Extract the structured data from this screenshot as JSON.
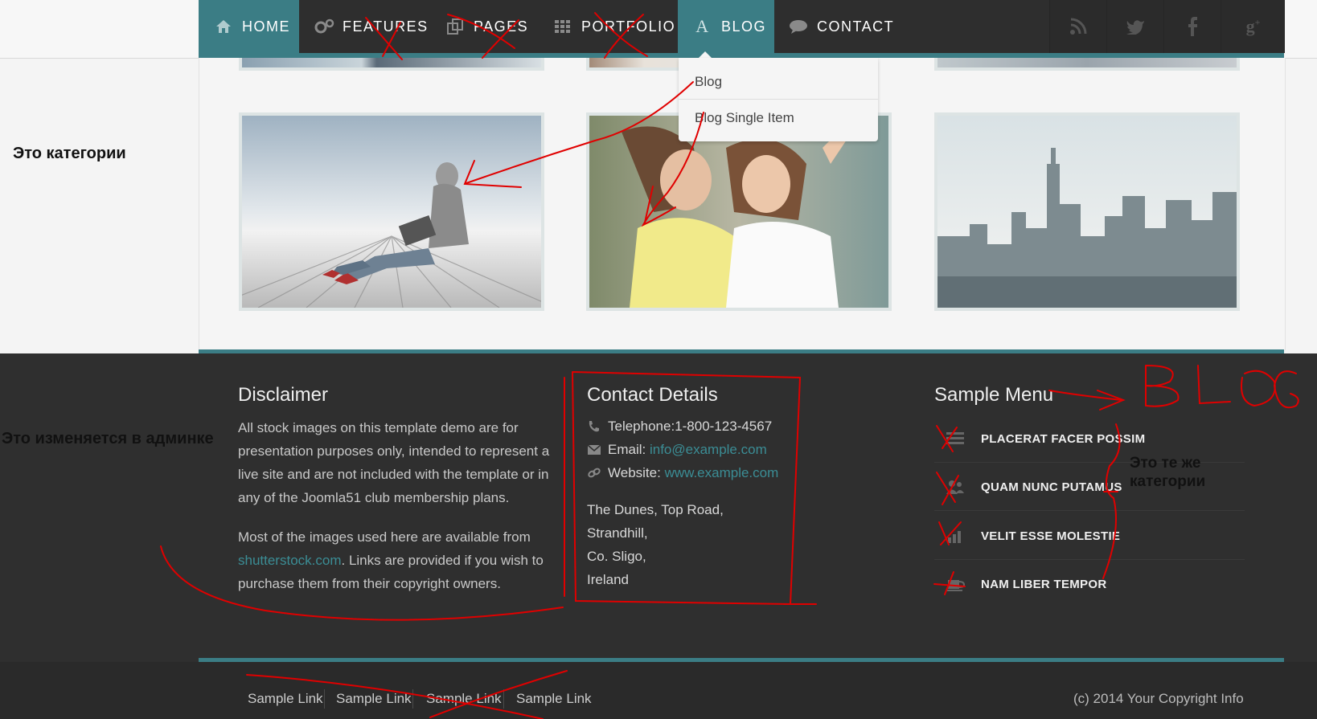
{
  "nav": {
    "items": [
      {
        "label": "HOME",
        "icon": "home-icon"
      },
      {
        "label": "FEATURES",
        "icon": "gears-icon"
      },
      {
        "label": "PAGES",
        "icon": "copy-icon"
      },
      {
        "label": "PORTFOLIO",
        "icon": "grid-icon"
      },
      {
        "label": "BLOG",
        "icon": "font-a-icon"
      },
      {
        "label": "CONTACT",
        "icon": "speech-bubble-icon"
      }
    ],
    "active": "BLOG",
    "social": [
      "rss-icon",
      "twitter-icon",
      "facebook-icon",
      "google-plus-icon"
    ]
  },
  "dropdown": {
    "items": [
      "Blog",
      "Blog Single Item"
    ]
  },
  "gallery": {
    "thumbs": [
      {
        "name": "hooded-man-laptop-photo"
      },
      {
        "name": "two-girls-photo"
      },
      {
        "name": "city-skyline-photo"
      }
    ]
  },
  "annotations": {
    "categories": "Это категории",
    "admin": "Это изменяется в админке",
    "same_categories": "Это те же\nкатегории",
    "blog_scribble": "BLOG"
  },
  "footer": {
    "disclaimer": {
      "title": "Disclaimer",
      "p1": "All stock images on this template demo are for presentation purposes only, intended to represent a live site and are not included with the template or in any of the Joomla51 club membership plans.",
      "p2_prefix": "Most of the images used here are available from ",
      "p2_link": "shutterstock.com",
      "p2_suffix": ". Links are provided if you wish to purchase them from their copyright owners."
    },
    "contact": {
      "title": "Contact Details",
      "telephone_label": "Telephone:",
      "telephone": "1-800-123-4567",
      "email_label": "Email: ",
      "email": "info@example.com",
      "website_label": "Website: ",
      "website": "www.example.com",
      "address": [
        "The Dunes, Top Road,",
        "Strandhill,",
        "Co. Sligo,",
        "Ireland"
      ]
    },
    "sample_menu": {
      "title": "Sample Menu",
      "items": [
        {
          "label": "PLACERAT FACER POSSIM",
          "icon": "list-icon"
        },
        {
          "label": "QUAM NUNC PUTAMUS",
          "icon": "users-icon"
        },
        {
          "label": "VELIT ESSE MOLESTIE",
          "icon": "bar-chart-icon"
        },
        {
          "label": "NAM LIBER TEMPOR",
          "icon": "coffee-icon"
        }
      ]
    }
  },
  "bottom": {
    "links": [
      "Sample Link",
      "Sample Link",
      "Sample Link",
      "Sample Link"
    ],
    "copyright": "(c) 2014 Your Copyright Info"
  },
  "colors": {
    "accent": "#3b7d85",
    "navbar": "#2e2e2e",
    "footer": "#2f2f2f",
    "annotation_red": "#e00000"
  }
}
